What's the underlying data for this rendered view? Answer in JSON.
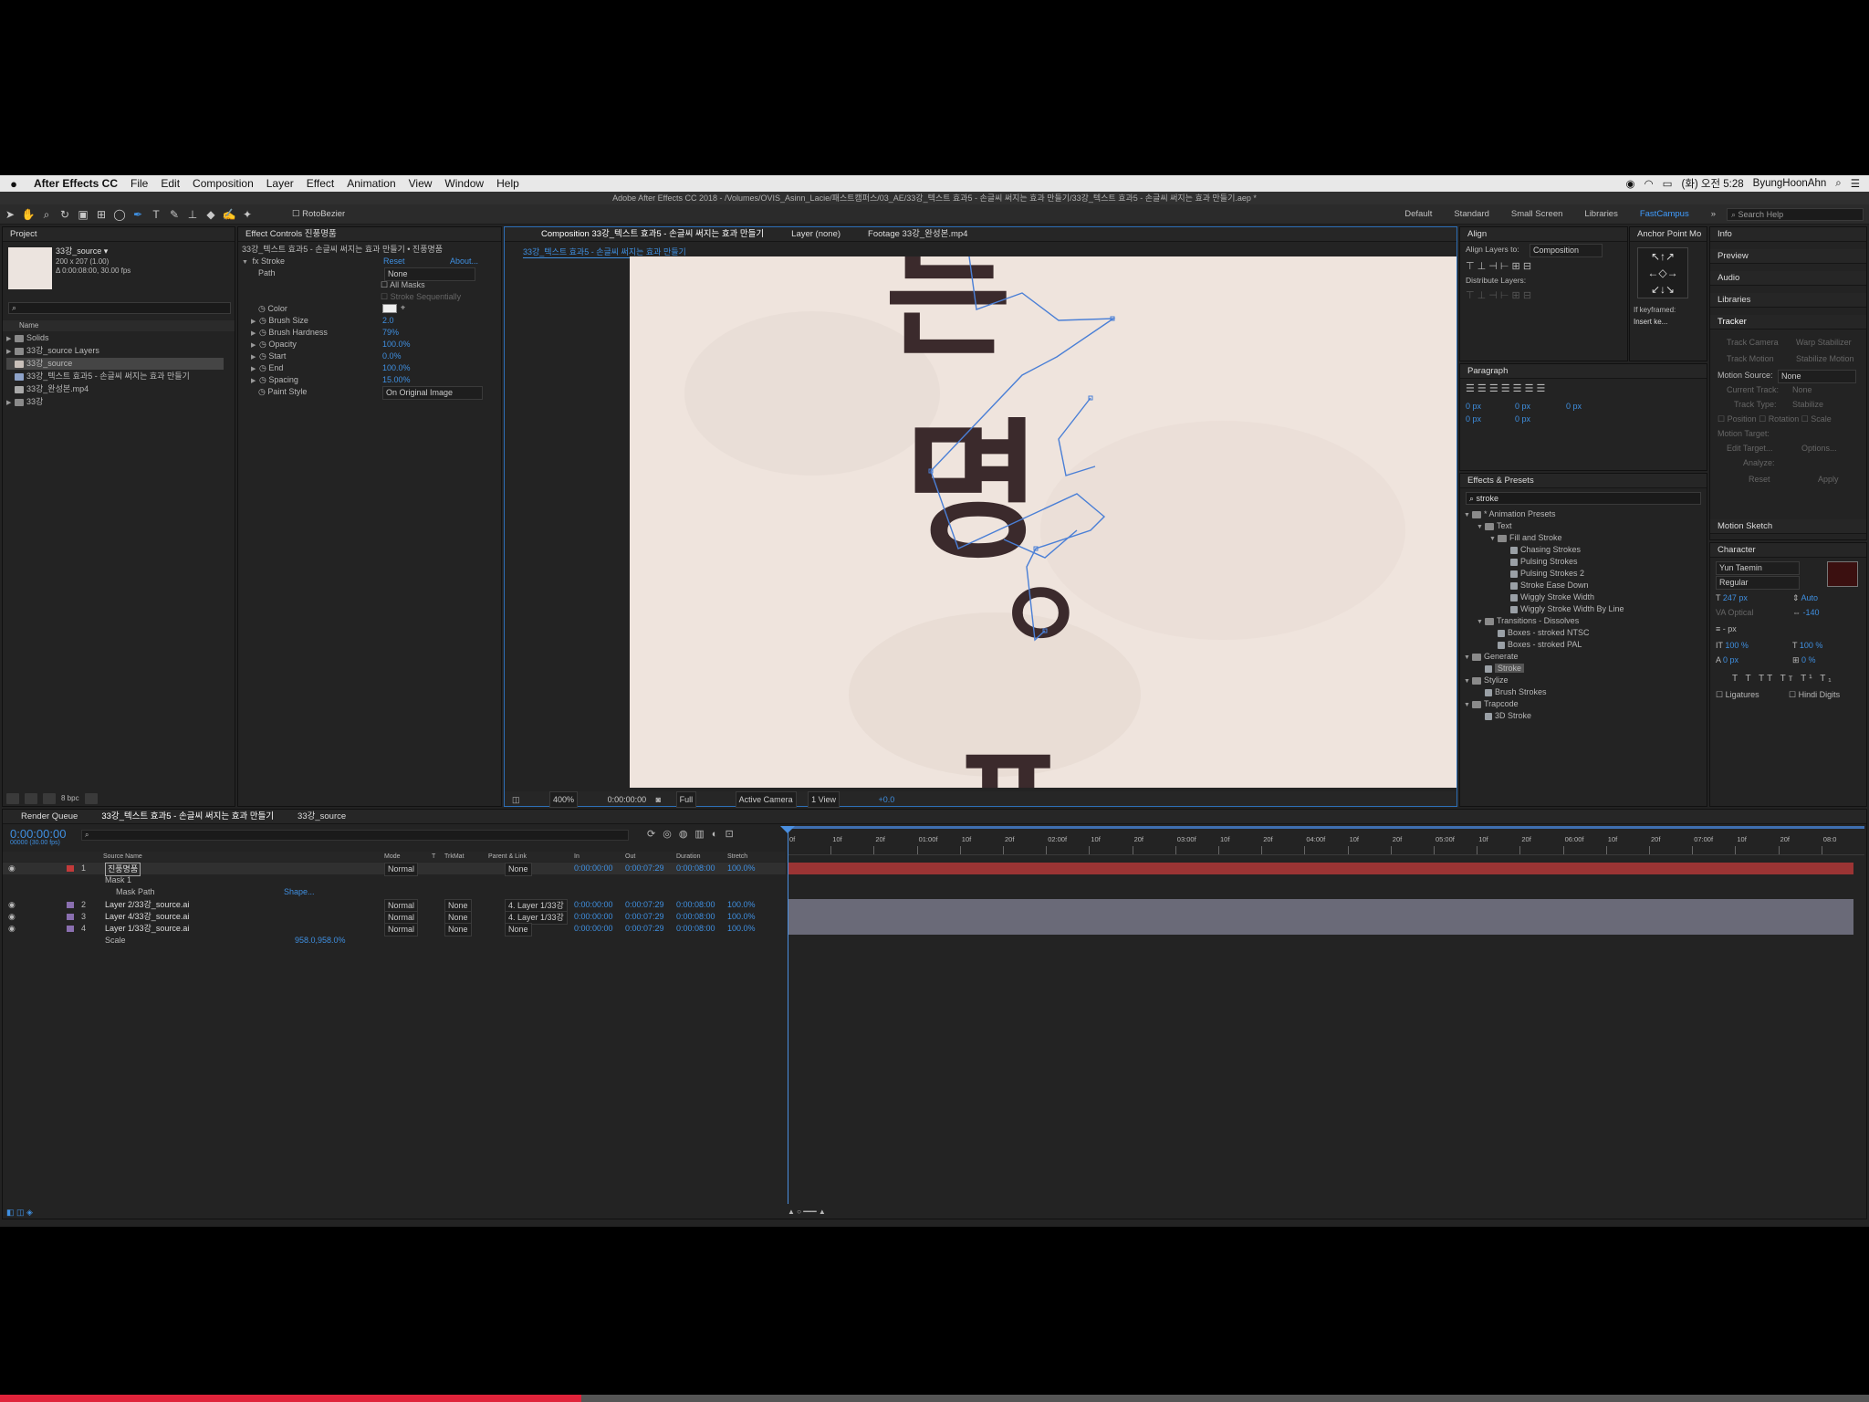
{
  "menubar": {
    "app": "After Effects CC",
    "items": [
      "File",
      "Edit",
      "Composition",
      "Layer",
      "Effect",
      "Animation",
      "View",
      "Window",
      "Help"
    ],
    "clock": "(화) 오전 5:28",
    "user": "ByungHoonAhn"
  },
  "title_bar": "Adobe After Effects CC 2018 - /Volumes/OVIS_Asinn_Lacie/패스트캠퍼스/03_AE/33강_텍스트 효과5 - 손글씨 써지는 효과 만들기/33강_텍스트 효과5 - 손글씨 써지는 효과 만들기.aep *",
  "toolbar": {
    "rotobrush": "RotoBezier",
    "workspaces": [
      "Default",
      "Standard",
      "Small Screen",
      "Libraries",
      "FastCampus"
    ],
    "active_workspace": "FastCampus",
    "search_placeholder": "Search Help"
  },
  "project": {
    "tab": "Project",
    "selected_name": "33강_source ▾",
    "selected_dims": "200 x 207 (1.00)",
    "selected_dur": "Δ 0:00:08:00, 30.00 fps",
    "column": "Name",
    "items": [
      "Solids",
      "33강_source Layers",
      "33강_source",
      "33강_텍스트 효과5 - 손글씨 써지는 효과 만들기",
      "33강_완성본.mp4",
      "33강"
    ],
    "bpc": "8 bpc"
  },
  "effect_controls": {
    "tab": "Effect Controls 진풍명품",
    "breadcrumb": "33강_텍스트 효과5 - 손글씨 써지는 효과 만들기 • 진풍명품",
    "effect": "Stroke",
    "reset": "Reset",
    "about": "About...",
    "path_label": "Path",
    "path_value": "None",
    "all_masks": "All Masks",
    "stroke_seq": "Stroke Sequentially",
    "props": [
      {
        "name": "Color",
        "value": ""
      },
      {
        "name": "Brush Size",
        "value": "2.0"
      },
      {
        "name": "Brush Hardness",
        "value": "79%"
      },
      {
        "name": "Opacity",
        "value": "100.0%"
      },
      {
        "name": "Start",
        "value": "0.0%"
      },
      {
        "name": "End",
        "value": "100.0%"
      },
      {
        "name": "Spacing",
        "value": "15.00%"
      },
      {
        "name": "Paint Style",
        "value": "On Original Image"
      }
    ]
  },
  "viewer": {
    "tabs": [
      "Composition 33강_텍스트 효과5 - 손글씨 써지는 효과 만들기",
      "Layer (none)",
      "Footage 33강_완성본.mp4"
    ],
    "subtab": "33강_텍스트 효과5 - 손글씨 써지는 효과 만들기",
    "glyphs": [
      "는",
      "명",
      "ㅇ",
      "ㅍ"
    ],
    "zoom": "400%",
    "time": "0:00:00:00",
    "resolution": "Full",
    "camera": "Active Camera",
    "view": "1 View",
    "exposure": "+0.0"
  },
  "align": {
    "tab": "Align",
    "align_to_label": "Align Layers to:",
    "align_to": "Composition",
    "distribute": "Distribute Layers:"
  },
  "anchor": {
    "tab": "Anchor Point Mo",
    "if_keyframed": "If keyframed:",
    "insert": "Insert ke..."
  },
  "paragraph": {
    "tab": "Paragraph",
    "values": [
      "0 px",
      "0 px",
      "0 px",
      "0 px",
      "0 px"
    ]
  },
  "effects_presets": {
    "tab": "Effects & Presets",
    "search": "stroke",
    "tree": [
      {
        "t": "* Animation Presets",
        "l": 0
      },
      {
        "t": "Text",
        "l": 1
      },
      {
        "t": "Fill and Stroke",
        "l": 2
      },
      {
        "t": "Chasing Strokes",
        "l": 3
      },
      {
        "t": "Pulsing Strokes",
        "l": 3
      },
      {
        "t": "Pulsing Strokes 2",
        "l": 3
      },
      {
        "t": "Stroke Ease Down",
        "l": 3
      },
      {
        "t": "Wiggly Stroke Width",
        "l": 3
      },
      {
        "t": "Wiggly Stroke Width By Line",
        "l": 3
      },
      {
        "t": "Transitions - Dissolves",
        "l": 1
      },
      {
        "t": "Boxes - stroked NTSC",
        "l": 2
      },
      {
        "t": "Boxes - stroked PAL",
        "l": 2
      },
      {
        "t": "Generate",
        "l": 0
      },
      {
        "t": "Stroke",
        "l": 1
      },
      {
        "t": "Stylize",
        "l": 0
      },
      {
        "t": "Brush Strokes",
        "l": 1
      },
      {
        "t": "Trapcode",
        "l": 0
      },
      {
        "t": "3D Stroke",
        "l": 1
      }
    ]
  },
  "right_panels": {
    "items": [
      "Info",
      "Preview",
      "Audio",
      "Libraries"
    ],
    "tracker": "Tracker",
    "track_camera": "Track Camera",
    "warp": "Warp Stabilizer",
    "track_motion": "Track Motion",
    "stabilize": "Stabilize Motion",
    "motion_source_label": "Motion Source:",
    "motion_source": "None",
    "current_track": "Current Track:",
    "current_track_value": "None",
    "track_type": "Track Type:",
    "track_type_value": "Stabilize",
    "position": "Position",
    "rotation": "Rotation",
    "scale": "Scale",
    "motion_target": "Motion Target:",
    "edit_target": "Edit Target...",
    "options": "Options...",
    "analyze": "Analyze:",
    "reset": "Reset",
    "apply": "Apply",
    "motion_sketch": "Motion Sketch"
  },
  "character": {
    "tab": "Character",
    "font": "Yun Taemin",
    "style": "Regular",
    "size": "247 px",
    "leading": "Auto",
    "kerning": "Optical",
    "tracking": "-140",
    "stroke_w": "- px",
    "vscale": "100 %",
    "hscale": "100 %",
    "baseline": "0 px",
    "tsume": "0 %",
    "ligatures": "Ligatures",
    "hindi": "Hindi Digits"
  },
  "timeline": {
    "tabs": [
      "Render Queue",
      "33강_텍스트 효과5 - 손글씨 써지는 효과 만들기",
      "33강_source"
    ],
    "timecode": "0:00:00:00",
    "fps": "00000 (30.00 fps)",
    "cols": [
      "Source Name",
      "Mode",
      "T",
      "TrkMat",
      "Parent & Link",
      "In",
      "Out",
      "Duration",
      "Stretch"
    ],
    "ruler": [
      "0f",
      "10f",
      "20f",
      "01:00f",
      "10f",
      "20f",
      "02:00f",
      "10f",
      "20f",
      "03:00f",
      "10f",
      "20f",
      "04:00f",
      "10f",
      "20f",
      "05:00f",
      "10f",
      "20f",
      "06:00f",
      "10f",
      "20f",
      "07:00f",
      "10f",
      "20f",
      "08:0"
    ],
    "layers": [
      {
        "num": "1",
        "name": "진풍명품",
        "mode": "Normal",
        "trk": "",
        "parent": "None",
        "in": "0:00:00:00",
        "out": "0:00:07:29",
        "dur": "0:00:08:00",
        "stretch": "100.0%",
        "color": "#c23a3a"
      },
      {
        "num": "2",
        "name": "Layer 2/33강_source.ai",
        "mode": "Normal",
        "trk": "None",
        "parent": "4. Layer 1/33강",
        "in": "0:00:00:00",
        "out": "0:00:07:29",
        "dur": "0:00:08:00",
        "stretch": "100.0%",
        "color": "#8a6fb0"
      },
      {
        "num": "3",
        "name": "Layer 4/33강_source.ai",
        "mode": "Normal",
        "trk": "None",
        "parent": "4. Layer 1/33강",
        "in": "0:00:00:00",
        "out": "0:00:07:29",
        "dur": "0:00:08:00",
        "stretch": "100.0%",
        "color": "#8a6fb0"
      },
      {
        "num": "4",
        "name": "Layer 1/33강_source.ai",
        "mode": "Normal",
        "trk": "None",
        "parent": "None",
        "in": "0:00:00:00",
        "out": "0:00:07:29",
        "dur": "0:00:08:00",
        "stretch": "100.0%",
        "color": "#8a6fb0"
      }
    ],
    "mask": "Mask 1",
    "mask_path": "Mask Path",
    "shape": "Shape...",
    "scale_label": "Scale",
    "scale_value": "958.0,958.0%"
  },
  "colors": {
    "accent": "#3f8fe0",
    "layer1": "#c23a3a",
    "progress": "#e0233a"
  },
  "video_progress": 0.311
}
